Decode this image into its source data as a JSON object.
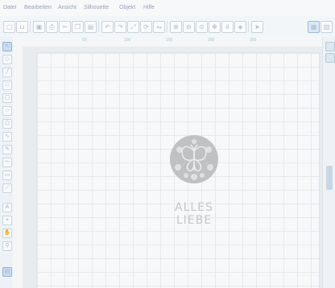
{
  "menu": [
    "Datei",
    "Bearbeiten",
    "Ansicht",
    "Silhouette",
    "Objekt",
    "Hilfe"
  ],
  "toolbar_icons": [
    "new-icon",
    "open-icon",
    "save-icon",
    "print-icon",
    "cut-icon",
    "copy-icon",
    "paste-icon",
    "undo-icon",
    "redo-icon",
    "zoom-in-icon",
    "zoom-out-icon",
    "select-icon",
    "rotate-icon",
    "pan-icon",
    "fill-icon"
  ],
  "left_tools": [
    "select-tool-icon",
    "edit-points-icon",
    "line-icon",
    "rect-icon",
    "rounded-rect-icon",
    "ellipse-icon",
    "polygon-icon",
    "curve-icon",
    "freehand-icon",
    "smooth-freehand-icon",
    "eraser-icon",
    "knife-icon",
    "text-icon",
    "eyedropper-icon",
    "pan-tool-icon",
    "zoom-tool-icon"
  ],
  "ruler_ticks": [
    "50",
    "100",
    "150",
    "200",
    "250"
  ],
  "design": {
    "line1": "ALLES",
    "line2": "LIEBE"
  },
  "colors": {
    "design_gray": "#bfc1c3",
    "accent": "#9ab9da"
  }
}
